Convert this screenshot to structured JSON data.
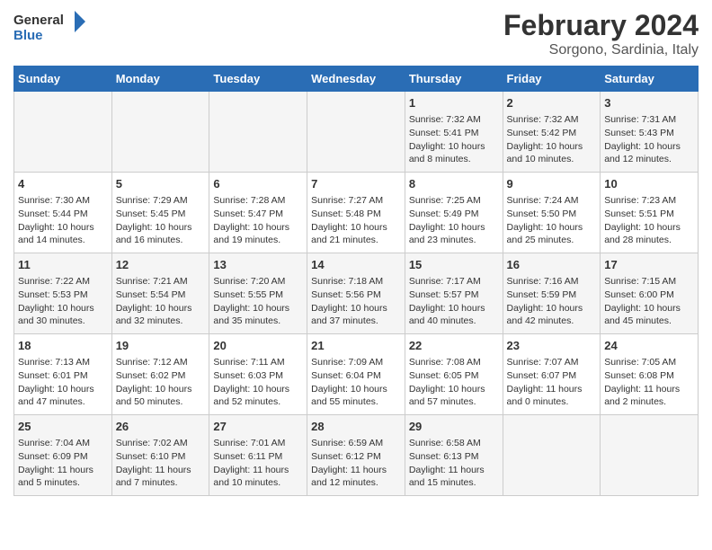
{
  "header": {
    "logo_general": "General",
    "logo_blue": "Blue",
    "main_title": "February 2024",
    "subtitle": "Sorgono, Sardinia, Italy"
  },
  "columns": [
    "Sunday",
    "Monday",
    "Tuesday",
    "Wednesday",
    "Thursday",
    "Friday",
    "Saturday"
  ],
  "weeks": [
    {
      "days": [
        {
          "num": "",
          "info": ""
        },
        {
          "num": "",
          "info": ""
        },
        {
          "num": "",
          "info": ""
        },
        {
          "num": "",
          "info": ""
        },
        {
          "num": "1",
          "info": "Sunrise: 7:32 AM\nSunset: 5:41 PM\nDaylight: 10 hours\nand 8 minutes."
        },
        {
          "num": "2",
          "info": "Sunrise: 7:32 AM\nSunset: 5:42 PM\nDaylight: 10 hours\nand 10 minutes."
        },
        {
          "num": "3",
          "info": "Sunrise: 7:31 AM\nSunset: 5:43 PM\nDaylight: 10 hours\nand 12 minutes."
        }
      ]
    },
    {
      "days": [
        {
          "num": "4",
          "info": "Sunrise: 7:30 AM\nSunset: 5:44 PM\nDaylight: 10 hours\nand 14 minutes."
        },
        {
          "num": "5",
          "info": "Sunrise: 7:29 AM\nSunset: 5:45 PM\nDaylight: 10 hours\nand 16 minutes."
        },
        {
          "num": "6",
          "info": "Sunrise: 7:28 AM\nSunset: 5:47 PM\nDaylight: 10 hours\nand 19 minutes."
        },
        {
          "num": "7",
          "info": "Sunrise: 7:27 AM\nSunset: 5:48 PM\nDaylight: 10 hours\nand 21 minutes."
        },
        {
          "num": "8",
          "info": "Sunrise: 7:25 AM\nSunset: 5:49 PM\nDaylight: 10 hours\nand 23 minutes."
        },
        {
          "num": "9",
          "info": "Sunrise: 7:24 AM\nSunset: 5:50 PM\nDaylight: 10 hours\nand 25 minutes."
        },
        {
          "num": "10",
          "info": "Sunrise: 7:23 AM\nSunset: 5:51 PM\nDaylight: 10 hours\nand 28 minutes."
        }
      ]
    },
    {
      "days": [
        {
          "num": "11",
          "info": "Sunrise: 7:22 AM\nSunset: 5:53 PM\nDaylight: 10 hours\nand 30 minutes."
        },
        {
          "num": "12",
          "info": "Sunrise: 7:21 AM\nSunset: 5:54 PM\nDaylight: 10 hours\nand 32 minutes."
        },
        {
          "num": "13",
          "info": "Sunrise: 7:20 AM\nSunset: 5:55 PM\nDaylight: 10 hours\nand 35 minutes."
        },
        {
          "num": "14",
          "info": "Sunrise: 7:18 AM\nSunset: 5:56 PM\nDaylight: 10 hours\nand 37 minutes."
        },
        {
          "num": "15",
          "info": "Sunrise: 7:17 AM\nSunset: 5:57 PM\nDaylight: 10 hours\nand 40 minutes."
        },
        {
          "num": "16",
          "info": "Sunrise: 7:16 AM\nSunset: 5:59 PM\nDaylight: 10 hours\nand 42 minutes."
        },
        {
          "num": "17",
          "info": "Sunrise: 7:15 AM\nSunset: 6:00 PM\nDaylight: 10 hours\nand 45 minutes."
        }
      ]
    },
    {
      "days": [
        {
          "num": "18",
          "info": "Sunrise: 7:13 AM\nSunset: 6:01 PM\nDaylight: 10 hours\nand 47 minutes."
        },
        {
          "num": "19",
          "info": "Sunrise: 7:12 AM\nSunset: 6:02 PM\nDaylight: 10 hours\nand 50 minutes."
        },
        {
          "num": "20",
          "info": "Sunrise: 7:11 AM\nSunset: 6:03 PM\nDaylight: 10 hours\nand 52 minutes."
        },
        {
          "num": "21",
          "info": "Sunrise: 7:09 AM\nSunset: 6:04 PM\nDaylight: 10 hours\nand 55 minutes."
        },
        {
          "num": "22",
          "info": "Sunrise: 7:08 AM\nSunset: 6:05 PM\nDaylight: 10 hours\nand 57 minutes."
        },
        {
          "num": "23",
          "info": "Sunrise: 7:07 AM\nSunset: 6:07 PM\nDaylight: 11 hours\nand 0 minutes."
        },
        {
          "num": "24",
          "info": "Sunrise: 7:05 AM\nSunset: 6:08 PM\nDaylight: 11 hours\nand 2 minutes."
        }
      ]
    },
    {
      "days": [
        {
          "num": "25",
          "info": "Sunrise: 7:04 AM\nSunset: 6:09 PM\nDaylight: 11 hours\nand 5 minutes."
        },
        {
          "num": "26",
          "info": "Sunrise: 7:02 AM\nSunset: 6:10 PM\nDaylight: 11 hours\nand 7 minutes."
        },
        {
          "num": "27",
          "info": "Sunrise: 7:01 AM\nSunset: 6:11 PM\nDaylight: 11 hours\nand 10 minutes."
        },
        {
          "num": "28",
          "info": "Sunrise: 6:59 AM\nSunset: 6:12 PM\nDaylight: 11 hours\nand 12 minutes."
        },
        {
          "num": "29",
          "info": "Sunrise: 6:58 AM\nSunset: 6:13 PM\nDaylight: 11 hours\nand 15 minutes."
        },
        {
          "num": "",
          "info": ""
        },
        {
          "num": "",
          "info": ""
        }
      ]
    }
  ]
}
